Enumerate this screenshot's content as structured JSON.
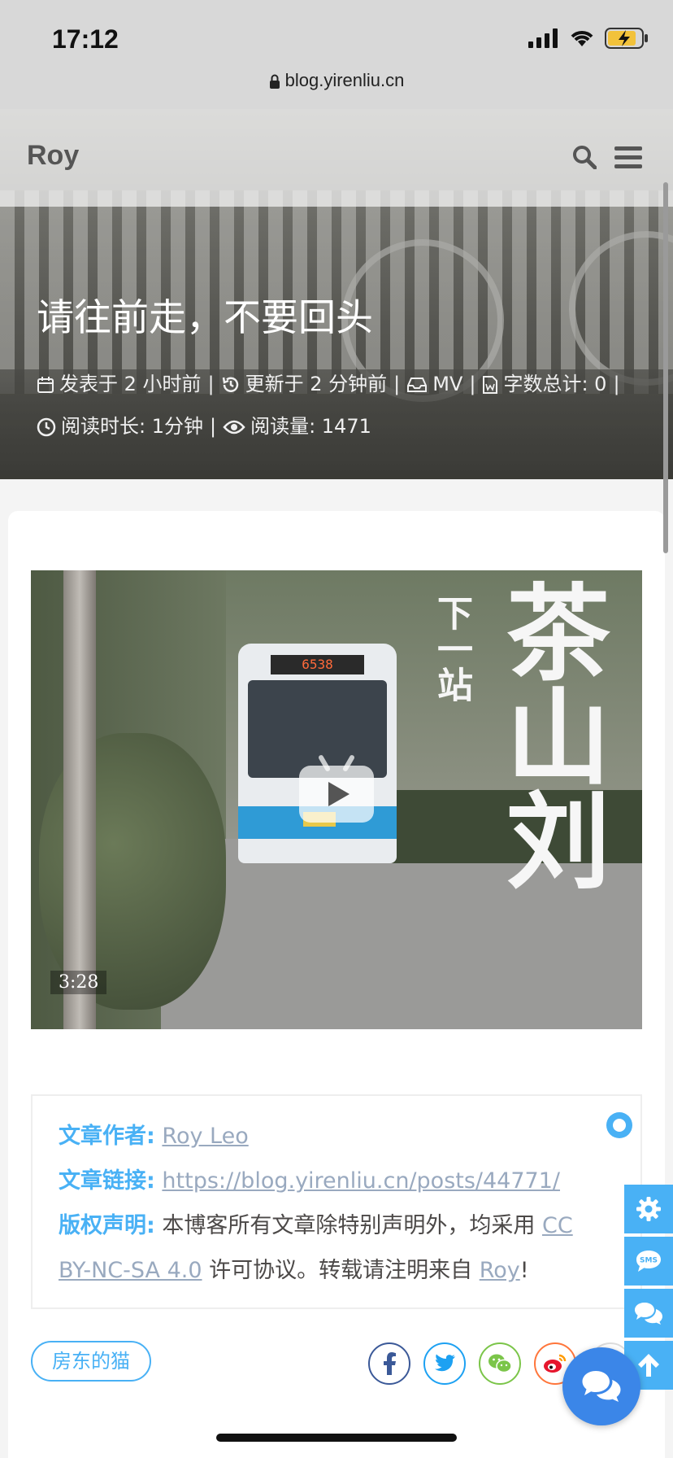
{
  "status_bar": {
    "time": "17:12",
    "url": "blog.yirenliu.cn"
  },
  "nav": {
    "logo": "Roy",
    "icons": [
      "search-icon",
      "menu-icon"
    ]
  },
  "post": {
    "title": "请往前走，不要回头",
    "meta": {
      "published": "发表于 2 小时前",
      "updated": "更新于 2 分钟前",
      "category": "MV",
      "wordcount": "字数总计: 0",
      "reading_time": "阅读时长: 1分钟",
      "views": "阅读量: 1471",
      "separator": "|"
    }
  },
  "video": {
    "duration": "3:28",
    "bus_sign": "6538",
    "overlay_text": {
      "small": "下一站",
      "big": "茶山刘"
    }
  },
  "copyright": {
    "author_label": "文章作者:",
    "author": "Roy Leo",
    "link_label": "文章链接:",
    "link": "https://blog.yirenliu.cn/posts/44771/",
    "license_label": "版权声明:",
    "license_text_before": "本博客所有文章除特别声明外，均采用",
    "license_name_part1": "CC",
    "license_name_part2": "BY-NC-SA 4.0",
    "license_text_after": "许可协议。转载请注明来自",
    "license_site": "Roy",
    "license_end": "!"
  },
  "tags": [
    "房东的猫"
  ],
  "share": [
    "facebook-icon",
    "twitter-icon",
    "wechat-icon",
    "weibo-icon"
  ],
  "side_buttons": [
    "gear-icon",
    "sms-icon",
    "comments-icon",
    "arrow-up-icon"
  ],
  "colors": {
    "accent": "#49b1f5",
    "link": "#99a9bf",
    "chat_fab": "#3b86e8"
  }
}
